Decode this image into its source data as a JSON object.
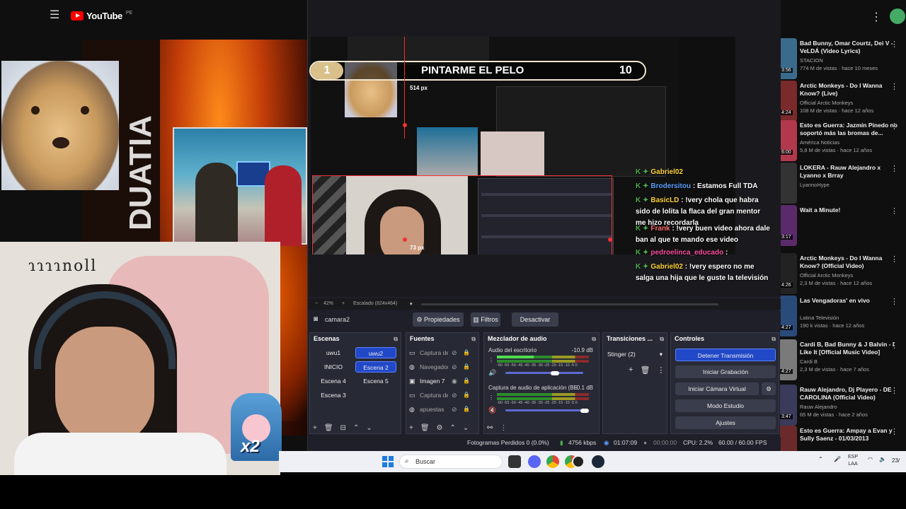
{
  "youtube": {
    "logo_text": "YouTube",
    "country_code": "PE",
    "recommendations": [
      {
        "title": "Bad Bunny, Omar Courtz, Dei V - VeLDÁ (Video Lyrics)",
        "channel": "STACION",
        "meta": "774 M de vistas · hace 10 meses",
        "duration": "3:56",
        "color": "#3a6b8c"
      },
      {
        "title": "Arctic Monkeys - Do I Wanna Know? (Live)",
        "channel": "Official Arctic Monkeys",
        "meta": "108 M de vistas · hace 12 años",
        "duration": "4:24",
        "color": "#7a2a2a"
      },
      {
        "title": "Esto es Guerra: Jazmín Pinedo no soportó más las bromas de...",
        "channel": "América Noticias",
        "meta": "5,8 M de vistas · hace 12 años",
        "duration": "6:00",
        "color": "#b2384b"
      },
      {
        "title": "LOKERA - Rauw Alejandro x Lyanno x Brray",
        "channel": "LyannoHype",
        "meta": "",
        "duration": "",
        "color": "#333"
      },
      {
        "title": "Wait a Minute!",
        "channel": "",
        "meta": "",
        "duration": "3:17",
        "color": "#5a2a6a"
      },
      {
        "title": "Arctic Monkeys - Do I Wanna Know? (Official Video)",
        "channel": "Official Arctic Monkeys",
        "meta": "2,3 M de vistas · hace 12 años",
        "duration": "4:26",
        "color": "#222"
      },
      {
        "title": "Las Vengadoras' en vivo",
        "channel": "Latina Televisión",
        "meta": "190 k vistas · hace 12 años",
        "duration": "4:27",
        "color": "#2a4a7a"
      },
      {
        "title": "Cardi B, Bad Bunny & J Balvin - I Like It [Official Music Video]",
        "channel": "Cardi B",
        "meta": "2,3 M de vistas · hace 7 años",
        "duration": "4:27",
        "color": "#7a7a7a"
      },
      {
        "title": "Rauw Alejandro, Dj Playero - DE CAROLINA (Official Video)",
        "channel": "Rauw Alejandro",
        "meta": "65 M de vistas · hace 2 años",
        "duration": "3:47",
        "color": "#3a3a5a"
      },
      {
        "title": "Esto es Guerra: Ampay a Evan y Sully Saenz - 01/03/2013",
        "channel": "",
        "meta": "",
        "duration": "",
        "color": "#6a2a2a"
      }
    ]
  },
  "webcam": {
    "sign_text": "ɿɿɿɿnoll",
    "badge": "x2"
  },
  "obs": {
    "preview": {
      "rank_left": "1",
      "song_title": "PINTARME EL PELO",
      "rank_right": "10",
      "dim_top": "514 px",
      "dim_bottom": "73 px"
    },
    "chat": [
      {
        "user": "Gabriel02",
        "text": "",
        "cls": "n-gab"
      },
      {
        "user": "Brodersitou",
        "text": ": Estamos Full TDA",
        "cls": "n-bro"
      },
      {
        "user": "BasicLD",
        "text": ": !very chola que habra sido de lolita la flaca del gran mentor me hizo recordarla",
        "cls": "n-bas"
      },
      {
        "user": "Frank",
        "text": ": !very buen video ahora dale ban al que te mando ese video",
        "cls": "n-fra"
      },
      {
        "user": "pedroelinca_educado",
        "text": ":",
        "cls": "n-ped"
      },
      {
        "user": "Gabriel02",
        "text": ": !very espero no me salga una hija que le guste la televisión",
        "cls": "n-gab"
      }
    ],
    "zoom": {
      "level": "42%",
      "scaling": "Escalado (824x464)"
    },
    "source_bar": {
      "source_name": "camara2",
      "properties": "Propiedades",
      "filters": "Filtros",
      "deactivate": "Desactivar"
    },
    "scenes": {
      "title": "Escenas",
      "items": [
        "uwu1",
        "uwu2",
        "INICIO",
        "Escena 2",
        "Escena 4",
        "Escena 5",
        "Escena 3"
      ],
      "active": "Escena 2"
    },
    "sources": {
      "title": "Fuentes",
      "items": [
        {
          "icon": "▭",
          "name": "Captura de pantalla",
          "visible": false
        },
        {
          "icon": "◍",
          "name": "Navegador",
          "visible": false
        },
        {
          "icon": "▣",
          "name": "Imagen 7",
          "visible": true
        },
        {
          "icon": "▭",
          "name": "Captura de juego",
          "visible": false
        },
        {
          "icon": "◍",
          "name": "apuestas",
          "visible": false
        }
      ]
    },
    "mixer": {
      "title": "Mezclador de audio",
      "channels": [
        {
          "name": "Audio del escritorio",
          "db": "-10.9 dB"
        },
        {
          "name": "Captura de audio de aplicación (BE",
          "db": "-0.1 dB"
        }
      ],
      "scale": "-60 -55 -50 -45 -40 -35 -30 -25 -20 -15 -10 -5 0"
    },
    "transitions": {
      "title": "Transiciones ...",
      "selected": "Stinger (2)"
    },
    "controls": {
      "title": "Controles",
      "stop_stream": "Detener Transmisión",
      "start_record": "Iniciar Grabación",
      "virtual_cam": "Iniciar Cámara Virtual",
      "studio_mode": "Modo Estudio",
      "settings": "Ajustes"
    },
    "status": {
      "dropped": "Fotogramas Perdidos 0 (0.0%)",
      "bitrate": "4756 kbps",
      "stream_time": "01:07:09",
      "rec_time": "00:00:00",
      "cpu": "CPU: 2.2%",
      "fps": "60.00 / 60.00 FPS"
    }
  },
  "taskbar": {
    "search_placeholder": "Buscar",
    "lang_top": "ESP",
    "lang_bottom": "LAA",
    "date_fragment": "23/"
  }
}
